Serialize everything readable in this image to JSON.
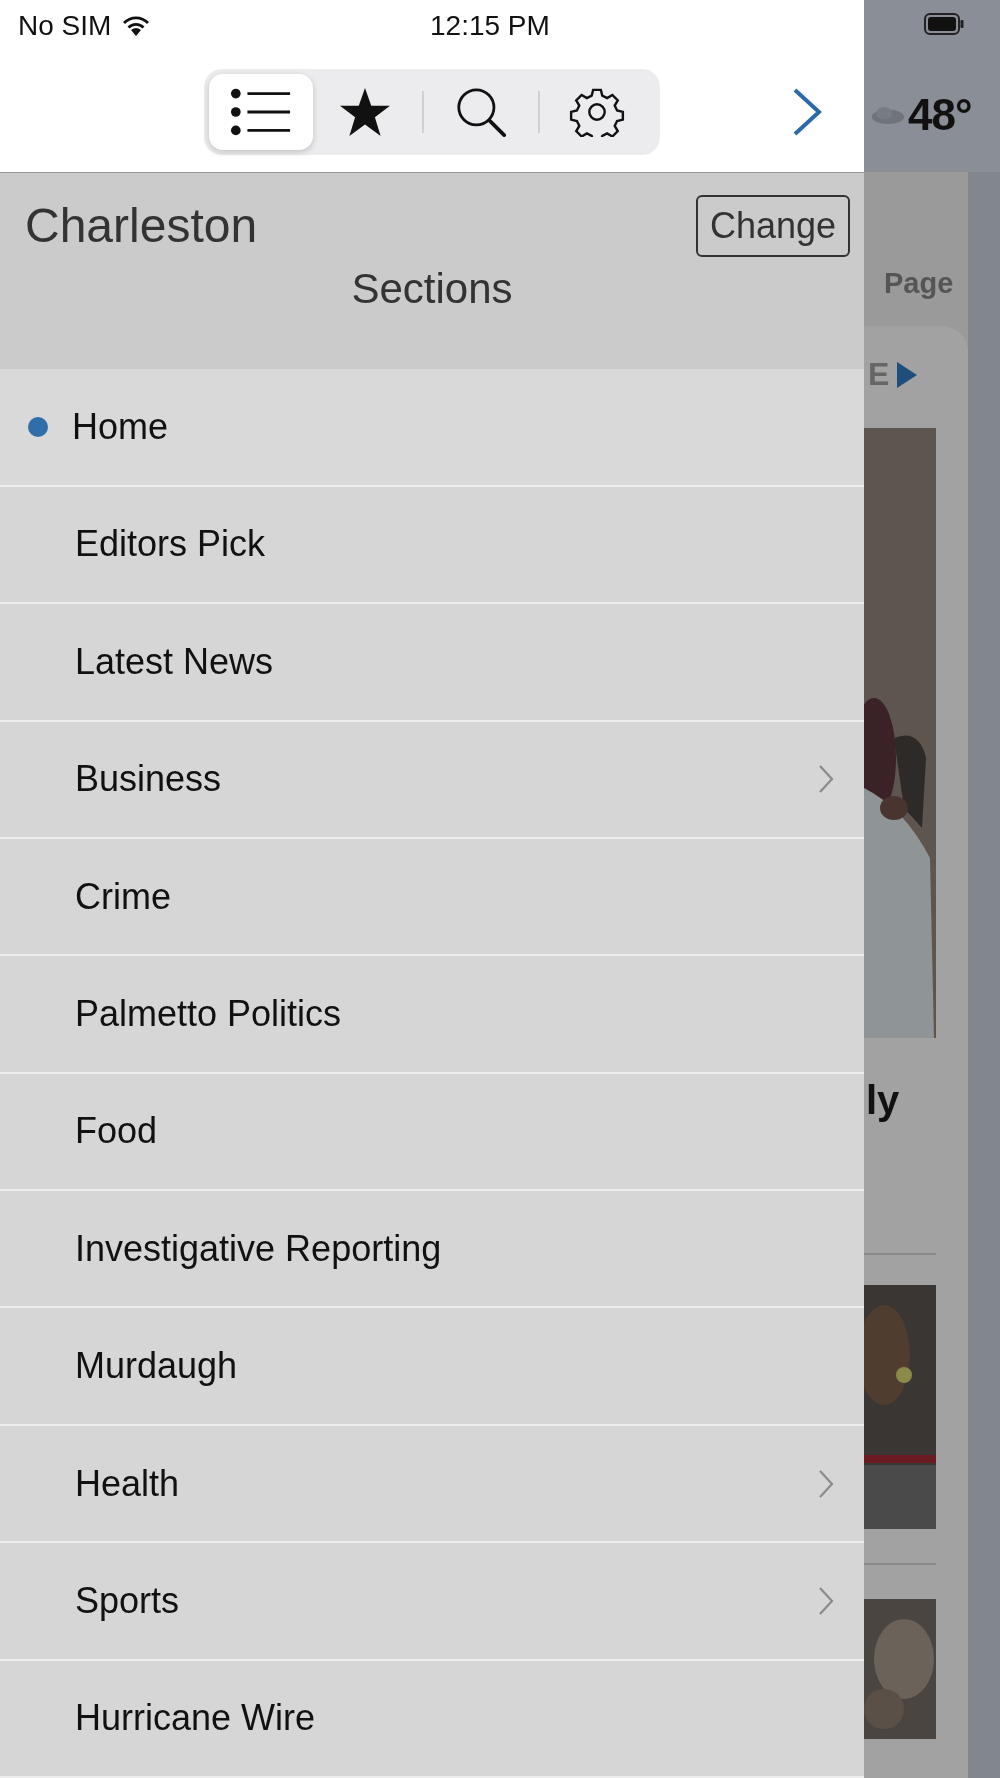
{
  "status_bar": {
    "carrier": "No SIM",
    "time": "12:15 PM"
  },
  "toolbar": {
    "tabs": [
      {
        "kind": "list",
        "selected": true
      },
      {
        "kind": "star",
        "selected": false
      },
      {
        "kind": "search",
        "selected": false
      },
      {
        "kind": "settings",
        "selected": false
      }
    ]
  },
  "location": {
    "city": "Charleston",
    "change_button": "Change"
  },
  "sections_title": "Sections",
  "sections": [
    {
      "label": "Home",
      "selected": true,
      "has_submenu": false
    },
    {
      "label": "Editors Pick",
      "selected": false,
      "has_submenu": false
    },
    {
      "label": "Latest News",
      "selected": false,
      "has_submenu": false
    },
    {
      "label": "Business",
      "selected": false,
      "has_submenu": true
    },
    {
      "label": "Crime",
      "selected": false,
      "has_submenu": false
    },
    {
      "label": "Palmetto Politics",
      "selected": false,
      "has_submenu": false
    },
    {
      "label": "Food",
      "selected": false,
      "has_submenu": false
    },
    {
      "label": "Investigative Reporting",
      "selected": false,
      "has_submenu": false
    },
    {
      "label": "Murdaugh",
      "selected": false,
      "has_submenu": false
    },
    {
      "label": "Health",
      "selected": false,
      "has_submenu": true
    },
    {
      "label": "Sports",
      "selected": false,
      "has_submenu": true
    },
    {
      "label": "Hurricane Wire",
      "selected": false,
      "has_submenu": false
    }
  ],
  "background_page": {
    "temperature": "48°",
    "heading_fragment": "Page",
    "link_fragment": "E",
    "headline_fragment": "ly"
  }
}
